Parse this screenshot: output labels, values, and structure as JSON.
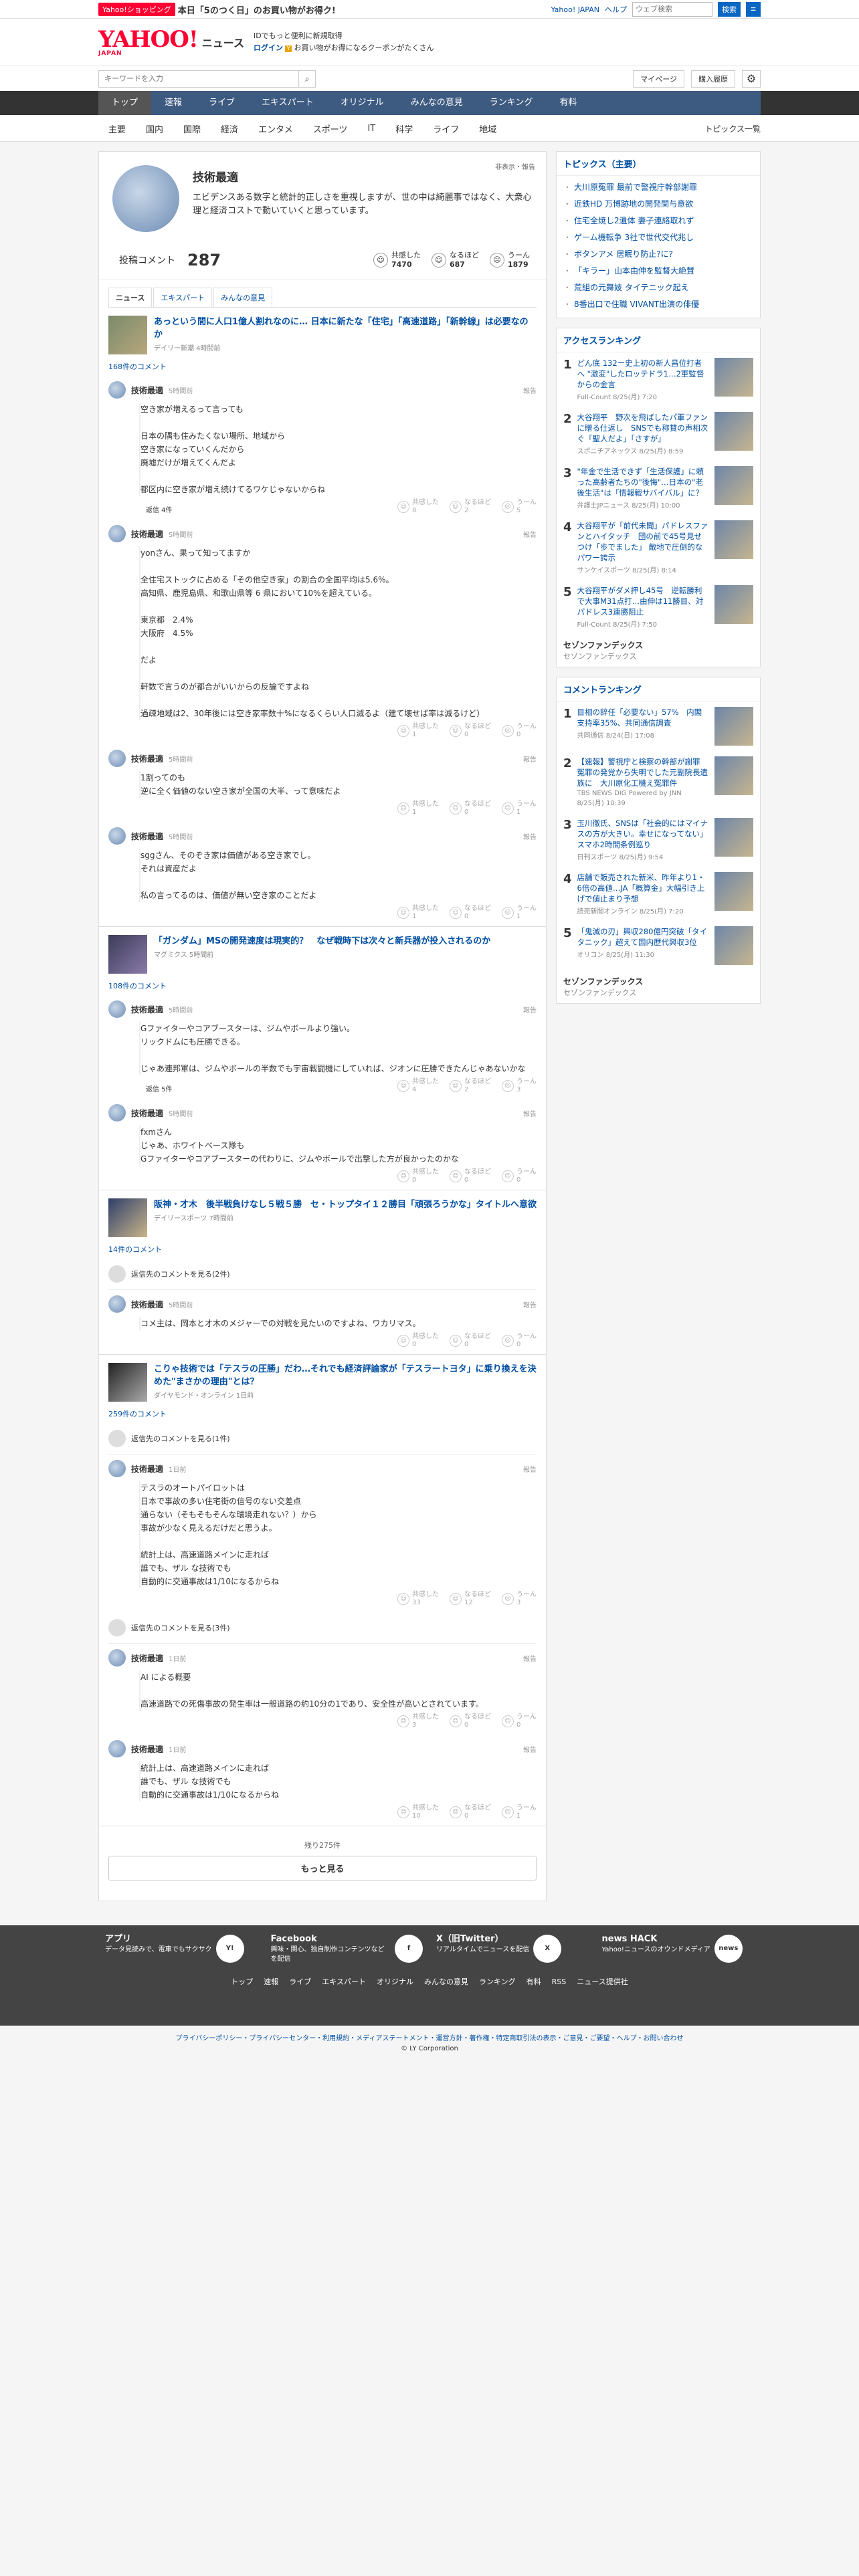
{
  "topbar": {
    "badge": "Yahoo!ショッピング",
    "promo": "本日「5のつく日」のお買い物がお得ク!",
    "links": [
      "Yahoo! JAPAN",
      "ヘルプ"
    ],
    "search_placeholder": "ウェブ検索",
    "search_btn": "検索"
  },
  "header": {
    "logo": "YAHOO!",
    "logo_sub": "JAPAN",
    "service": "ニュース",
    "info1": "IDでもっと便利に新規取得",
    "info2": "ログイン",
    "info3": "お買い物がお得になるクーポンがたくさん"
  },
  "toolbar": {
    "keyword_placeholder": "キーワードを入力",
    "mypage": "マイページ",
    "history": "購入履歴"
  },
  "mainnav": [
    "トップ",
    "速報",
    "ライブ",
    "エキスパート",
    "オリジナル",
    "みんなの意見",
    "ランキング",
    "有料"
  ],
  "subnav": [
    "主要",
    "国内",
    "国際",
    "経済",
    "エンタメ",
    "スポーツ",
    "IT",
    "科学",
    "ライフ",
    "地域"
  ],
  "subnav_right": "トピックス一覧",
  "profile": {
    "name": "技術最適",
    "desc": "エビデンスある数字と統計的正しさを重視しますが、世の中は綺麗事ではなく、大衆心理と経済コストで動いていくと思っています。",
    "link": "非表示・報告"
  },
  "stats": {
    "label": "投稿コメント",
    "count": "287",
    "reacts": [
      {
        "label": "共感した",
        "n": "7470"
      },
      {
        "label": "なるほど",
        "n": "687"
      },
      {
        "label": "うーん",
        "n": "1879"
      }
    ]
  },
  "tabs": [
    "ニュース",
    "エキスパート",
    "みんなの意見"
  ],
  "articles": [
    {
      "title": "あっという間に人口1億人割れなのに… 日本に新たな「住宅」「高速道路」「新幹線」は必要なのか",
      "src": "デイリー新潮 4時間前",
      "ccount": "168件のコメント",
      "comments": [
        {
          "name": "技術最適",
          "time": "5時間前",
          "text": "空き家が増えるって言っても\n\n日本の隅も住みたくない場所、地域から\n空き家になっていくんだから\n廃墟だけが増えてくんだよ\n\n都区内に空き家が増え続けてるワケじゃないからね",
          "r": [
            "8",
            "2",
            "5"
          ],
          "reply": "返信 4件"
        },
        {
          "name": "技術最適",
          "time": "5時間前",
          "text": "yonさん、果って知ってますか\n\n全住宅ストックに占める「その他空き家」の割合の全国平均は5.6%。\n高知県、鹿児島県、和歌山県等 6 県において10%を超えている。\n\n東京都　2.4%\n大阪府　4.5%\n\nだよ\n\n軒数で言うのが都合がいいからの反論ですよね\n\n過疎地域は2、30年後には空き家率数十%になるくらい人口減るよ（建て壊せば率は減るけど）",
          "r": [
            "1",
            "0",
            "0"
          ],
          "reply": ""
        },
        {
          "name": "技術最適",
          "time": "5時間前",
          "text": "1割ってのも\n逆に全く価値のない空き家が全国の大半、って意味だよ",
          "r": [
            "1",
            "0",
            "1"
          ],
          "reply": ""
        },
        {
          "name": "技術最適",
          "time": "5時間前",
          "text": "sggさん、そのぞき家は価値がある空き家でし。\nそれは資産だよ\n\n私の言ってるのは、価値が無い空き家のことだよ",
          "r": [
            "1",
            "0",
            "1"
          ],
          "reply": ""
        }
      ]
    },
    {
      "title": "「ガンダム」MSの開発速度は現実的？　なぜ戦時下は次々と新兵器が投入されるのか",
      "src": "マグミクス 5時間前",
      "ccount": "108件のコメント",
      "comments": [
        {
          "name": "技術最適",
          "time": "5時間前",
          "text": "Gファイターやコアブースターは、ジムやボールより強い。\nリックドムにも圧勝できる。\n\nじゃあ連邦軍は、ジムやボールの半数でも宇宙戦闘機にしていれば、ジオンに圧勝できたんじゃあないかな",
          "r": [
            "4",
            "2",
            "3"
          ],
          "reply": "返信 5件"
        },
        {
          "name": "技術最適",
          "time": "5時間前",
          "text": "fxmさん\nじゃあ、ホワイトベース隊も\nGファイターやコアブースターの代わりに、ジムやボールで出撃した方が良かったのかな",
          "r": [
            "0",
            "0",
            "0"
          ],
          "reply": ""
        }
      ]
    },
    {
      "title": "阪神・才木　後半戦負けなし５戦５勝　セ・トップタイ１２勝目「頑張ろうかな」タイトルへ意欲",
      "src": "デイリースポーツ 7時間前",
      "ccount": "14件のコメント",
      "hidden": "返信先のコメントを見る(2件)",
      "comments": [
        {
          "name": "技術最適",
          "time": "5時間前",
          "text": "コメ主は、岡本と才木のメジャーでの対戦を見たいのですよね、ワカリマス。",
          "r": [
            "0",
            "0",
            "0"
          ],
          "reply": ""
        }
      ]
    },
    {
      "title": "こりゃ技術では「テスラの圧勝」だわ…それでも経済評論家が「テスラートヨタ」に乗り換えを決めた\"まさかの理由\"とは？",
      "src": "ダイヤモンド・オンライン 1日前",
      "ccount": "259件のコメント",
      "hidden": "返信先のコメントを見る(1件)",
      "hidden2": "返信先のコメントを見る(3件)",
      "comments": [
        {
          "name": "技術最適",
          "time": "1日前",
          "text": "テスラのオートパイロットは\n日本で事故の多い住宅街の信号のない交差点\n通らない（そもそもそんな環境走れない？）から\n事故が少なく見えるだけだと思うよ。\n\n統計上は、高速道路メインに走れば\n誰でも、ザル な技術でも\n自動的に交通事故は1/10になるからね",
          "r": [
            "33",
            "12",
            "3"
          ],
          "reply": ""
        },
        {
          "name": "技術最適",
          "time": "1日前",
          "text": "AI による概要\n\n高速道路での死傷事故の発生率は一般道路の約10分の1であり、安全性が高いとされています。",
          "r": [
            "3",
            "0",
            "0"
          ],
          "reply": ""
        },
        {
          "name": "技術最適",
          "time": "1日前",
          "text": "統計上は、高速道路メインに走れば\n誰でも、ザル な技術でも\n自動的に交通事故は1/10になるからね",
          "r": [
            "10",
            "0",
            "1"
          ],
          "reply": ""
        }
      ]
    }
  ],
  "react_labels": [
    "共感した",
    "なるほど",
    "うーん"
  ],
  "report": "報告",
  "more": {
    "remain": "残り275件",
    "btn": "もっと見る"
  },
  "topics": {
    "heading": "トピックス（主要）",
    "items": [
      "大川原冤罪 最前で警視庁幹部謝罪",
      "近鉄HD 万博跡地の開発関与意欲",
      "住宅全焼し2遺体 妻子連絡取れず",
      "ゲーム機転争 3社で世代交代兆し",
      "ボタンアメ 居眠り防止?に?",
      "「キラー」山本由伸を監督大絶賛",
      "荒組の元舞妓 タイテニック起え",
      "8番出口で住職 VIVANT出演の俳優"
    ]
  },
  "access": {
    "heading": "アクセスランキング",
    "items": [
      {
        "t": "どん底 132ー史上初の新人昌位打者へ \"激変\"したロッテドラ1…2軍監督からの金言",
        "s": "Full-Count 8/25(月) 7:20"
      },
      {
        "t": "大谷翔平　野次を飛ばしたパ軍ファンに贈る仕返し　SNSでも称賛の声相次ぐ「聖人だよ」「さすが」",
        "s": "スポニチアネックス 8/25(月) 8:59"
      },
      {
        "t": "\"年金で生活できず「生活保護」に頼った高齢者たちの\"後悔\"…日本の\"老後生活\"は「情報戦サバイバル」に？",
        "s": "弁護士JPニュース 8/25(月) 10:00"
      },
      {
        "t": "大谷翔平が「前代未聞」パドレスファンとハイタッチ　団の前で45号見せつけ「歩でました」 敵地で圧倒的なパワー誇示",
        "s": "サンケイスポーツ 8/25(月) 8:14"
      },
      {
        "t": "大谷翔平がダメ押し45号　逆転勝利で大事M31点打…由伸は11勝目、対パドレス3連勝阻止",
        "s": "Full-Count 8/25(月) 7:50"
      }
    ]
  },
  "pr1": {
    "title": "セゾンファンデックス",
    "sub": "セゾンファンデックス"
  },
  "cranking": {
    "heading": "コメントランキング",
    "items": [
      {
        "t": "目相の辞任「必要ない」57%　内閣支持率35%、共同通信調査",
        "s": "共同通信 8/24(日) 17:08"
      },
      {
        "t": "【速報】警視庁と検察の幹部が謝罪　冤罪の発覚から失明でした元副院長遺族に　大川原化工機え冤罪件",
        "s": "TBS NEWS DIG Powered by JNN 8/25(月) 10:39"
      },
      {
        "t": "玉川徹氏、SNSは「社会的にはマイナスの方が大きい。幸せになってない」 スマホ2時間条例巡り",
        "s": "日刊スポーツ 8/25(月) 9:54"
      },
      {
        "t": "店舗で販売された新米、昨年より1・6倍の高値…JA「概算金」大幅引き上げで値止まり予想",
        "s": "読売新聞オンライン 8/25(月) 7:20"
      },
      {
        "t": "「鬼滅の刃」興収280億円突破「タイタニック」超えて国内歴代興収3位",
        "s": "オリコン 8/25(月) 11:30"
      }
    ]
  },
  "pr2": {
    "title": "セゾンファンデックス",
    "sub": "セゾンファンデックス"
  },
  "footer": {
    "cols": [
      {
        "title": "アプリ",
        "desc": "データ見読みで、電車でもサクサク",
        "icon": "Y!"
      },
      {
        "title": "Facebook",
        "desc": "興味・関心、独自制作コンテンツなどを配信",
        "icon": "f"
      },
      {
        "title": "X（旧Twitter）",
        "desc": "リアルタイムでニュースを配信",
        "icon": "X"
      },
      {
        "title": "news HACK",
        "desc": "Yahoo!ニュースのオウンドメディア",
        "icon": "news"
      }
    ],
    "links": [
      "トップ",
      "速報",
      "ライブ",
      "エキスパート",
      "オリジナル",
      "みんなの意見",
      "ランキング",
      "有料",
      "RSS",
      "ニュース提供社"
    ]
  },
  "bottom": {
    "links": "プライバシーポリシー・プライバシーセンター・利用規約・メディアステートメント・運営方針・著作権・特定商取引法の表示・ご意見・ご要望・ヘルプ・お問い合わせ",
    "copy": "© LY Corporation"
  }
}
